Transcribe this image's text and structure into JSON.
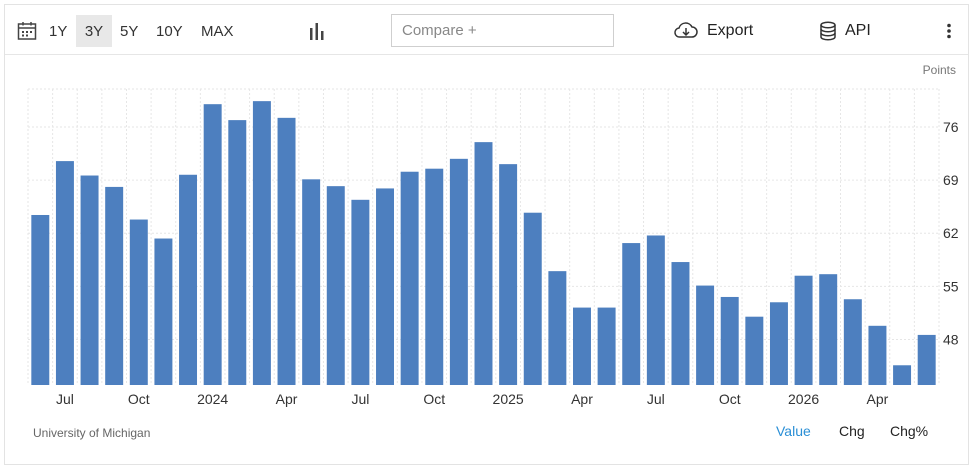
{
  "toolbar": {
    "calendar_icon": "calendar-icon",
    "ranges": [
      {
        "label": "1Y",
        "active": false
      },
      {
        "label": "3Y",
        "active": true
      },
      {
        "label": "5Y",
        "active": false
      },
      {
        "label": "10Y",
        "active": false
      },
      {
        "label": "MAX",
        "active": false
      }
    ],
    "chart_type_icon": "bar-chart-icon",
    "compare_placeholder": "Compare +",
    "export_label": "Export",
    "api_label": "API",
    "more_icon": "vertical-dots-icon"
  },
  "footer": {
    "source": "University of Michigan",
    "views": [
      {
        "label": "Value",
        "active": true
      },
      {
        "label": "Chg",
        "active": false
      },
      {
        "label": "Chg%",
        "active": false
      }
    ]
  },
  "colors": {
    "bar": "#4d7fbf",
    "active_link": "#2a8fd6",
    "grid": "#e6e6e6"
  },
  "chart_data": {
    "type": "bar",
    "unit_label": "Points",
    "y_ticks": [
      48,
      55,
      62,
      69,
      76
    ],
    "ylim": [
      42,
      81
    ],
    "x_tick_labels": [
      {
        "index": 1,
        "label": "Jul"
      },
      {
        "index": 4,
        "label": "Oct"
      },
      {
        "index": 7,
        "label": "2024"
      },
      {
        "index": 10,
        "label": "Apr"
      },
      {
        "index": 13,
        "label": "Jul"
      },
      {
        "index": 16,
        "label": "Oct"
      },
      {
        "index": 19,
        "label": "2025"
      },
      {
        "index": 22,
        "label": "Apr"
      },
      {
        "index": 25,
        "label": "Jul"
      },
      {
        "index": 28,
        "label": "Oct"
      },
      {
        "index": 31,
        "label": "2026"
      },
      {
        "index": 34,
        "label": "Apr"
      }
    ],
    "categories": [
      "2023-06",
      "2023-07",
      "2023-08",
      "2023-09",
      "2023-10",
      "2023-11",
      "2023-12",
      "2024-01",
      "2024-02",
      "2024-03",
      "2024-04",
      "2024-05",
      "2024-06",
      "2024-07",
      "2024-08",
      "2024-09",
      "2024-10",
      "2024-11",
      "2024-12",
      "2025-01",
      "2025-02",
      "2025-03",
      "2025-04",
      "2025-05",
      "2025-06",
      "2025-07",
      "2025-08",
      "2025-09",
      "2025-10",
      "2025-11",
      "2025-12",
      "2026-01",
      "2026-02",
      "2026-03",
      "2026-04",
      "2026-05",
      "2026-06"
    ],
    "values": [
      64.4,
      71.5,
      69.6,
      68.1,
      63.8,
      61.3,
      69.7,
      79.0,
      76.9,
      79.4,
      77.2,
      69.1,
      68.2,
      66.4,
      67.9,
      70.1,
      70.5,
      71.8,
      74.0,
      71.1,
      64.7,
      57.0,
      52.2,
      52.2,
      60.7,
      61.7,
      58.2,
      55.1,
      53.6,
      51.0,
      52.9,
      56.4,
      56.6,
      53.3,
      49.8,
      44.6,
      48.6
    ]
  }
}
